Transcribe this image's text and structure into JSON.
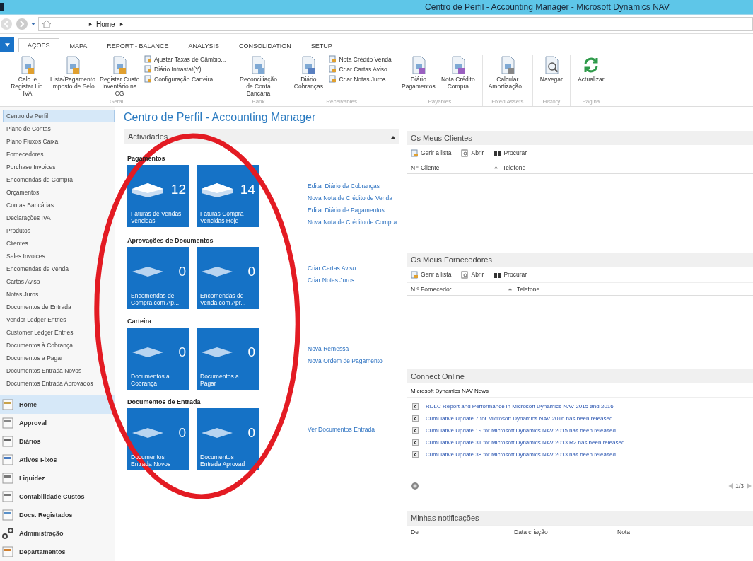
{
  "window": {
    "title": "Centro de Perfil - Accounting Manager - Microsoft Dynamics NAV"
  },
  "address": {
    "crumb": "Home"
  },
  "ribbon": {
    "tabs": [
      {
        "label": "AÇÕES",
        "selected": true
      },
      {
        "label": "MAPA",
        "selected": false
      },
      {
        "label": "REPORT - BALANCE",
        "selected": false
      },
      {
        "label": "ANALYSIS",
        "selected": false
      },
      {
        "label": "CONSOLIDATION",
        "selected": false
      },
      {
        "label": "SETUP",
        "selected": false
      }
    ],
    "groups": [
      {
        "label": "Geral",
        "items": [
          {
            "label": "Calc. e Registar Liq. IVA",
            "kind": "large"
          },
          {
            "label": "Lista/Pagamento Imposto de Selo",
            "kind": "large"
          },
          {
            "label": "Registar Custo Inventário na CG",
            "kind": "large"
          },
          {
            "label": "Ajustar Taxas de Câmbio...",
            "kind": "small"
          },
          {
            "label": "Diário Intrastat(Y)",
            "kind": "small"
          },
          {
            "label": "Configuração Carteira",
            "kind": "small"
          }
        ]
      },
      {
        "label": "Bank",
        "items": [
          {
            "label": "Reconciliação de Conta Bancária",
            "kind": "large"
          }
        ]
      },
      {
        "label": "Receivables",
        "items": [
          {
            "label": "Diário Cobranças",
            "kind": "large"
          },
          {
            "label": "Nota Crédito Venda",
            "kind": "small"
          },
          {
            "label": "Criar Cartas Aviso...",
            "kind": "small"
          },
          {
            "label": "Criar Notas Juros...",
            "kind": "small"
          }
        ]
      },
      {
        "label": "Payables",
        "items": [
          {
            "label": "Diário Pagamentos",
            "kind": "large"
          },
          {
            "label": "Nota Crédito Compra",
            "kind": "large"
          }
        ]
      },
      {
        "label": "Fixed Assets",
        "items": [
          {
            "label": "Calcular Amortização...",
            "kind": "large"
          }
        ]
      },
      {
        "label": "History",
        "items": [
          {
            "label": "Navegar",
            "kind": "large"
          }
        ]
      },
      {
        "label": "Página",
        "items": [
          {
            "label": "Actualizar",
            "kind": "large"
          }
        ]
      }
    ]
  },
  "sidebar": {
    "items": [
      {
        "label": "Centro de Perfil",
        "selected": true
      },
      {
        "label": "Plano de Contas",
        "selected": false
      },
      {
        "label": "Plano Fluxos Caixa",
        "selected": false
      },
      {
        "label": "Fornecedores",
        "selected": false
      },
      {
        "label": "Purchase Invoices",
        "selected": false
      },
      {
        "label": "Encomendas de Compra",
        "selected": false
      },
      {
        "label": "Orçamentos",
        "selected": false
      },
      {
        "label": "Contas Bancárias",
        "selected": false
      },
      {
        "label": "Declarações IVA",
        "selected": false
      },
      {
        "label": "Produtos",
        "selected": false
      },
      {
        "label": "Clientes",
        "selected": false
      },
      {
        "label": "Sales Invoices",
        "selected": false
      },
      {
        "label": "Encomendas de Venda",
        "selected": false
      },
      {
        "label": "Cartas Aviso",
        "selected": false
      },
      {
        "label": "Notas Juros",
        "selected": false
      },
      {
        "label": "Documentos de Entrada",
        "selected": false
      },
      {
        "label": "Vendor Ledger Entries",
        "selected": false
      },
      {
        "label": "Customer Ledger Entries",
        "selected": false
      },
      {
        "label": "Documentos à Cobrança",
        "selected": false
      },
      {
        "label": "Documentos a Pagar",
        "selected": false
      },
      {
        "label": "Documentos Entrada Novos",
        "selected": false
      },
      {
        "label": "Documentos Entrada Aprovados",
        "selected": false
      }
    ],
    "nav": [
      {
        "label": "Home",
        "selected": true
      },
      {
        "label": "Approval",
        "selected": false
      },
      {
        "label": "Diários",
        "selected": false
      },
      {
        "label": "Ativos Fixos",
        "selected": false
      },
      {
        "label": "Liquidez",
        "selected": false
      },
      {
        "label": "Contabilidade Custos",
        "selected": false
      },
      {
        "label": "Docs. Registados",
        "selected": false
      },
      {
        "label": "Administração",
        "selected": false
      },
      {
        "label": "Departamentos",
        "selected": false
      }
    ]
  },
  "page_title": "Centro de Perfil - Accounting Manager",
  "activities": {
    "title": "Actividades",
    "expanded": true,
    "sections": [
      {
        "title": "Pagamentos",
        "tiles": [
          {
            "count": "12",
            "label": "Faturas de Vendas Vencidas",
            "kind": "stack"
          },
          {
            "count": "14",
            "label": "Faturas Compra Vencidas Hoje",
            "kind": "stack"
          }
        ],
        "links": [
          "Editar Diário de Cobranças",
          "Nova Nota de Crédito de Venda",
          "Editar Diário de Pagamentos",
          "Nova Nota de Crédito de Compra"
        ]
      },
      {
        "title": "Aprovações de Documentos",
        "tiles": [
          {
            "count": "0",
            "label": "Encomendas de Compra com Ap...",
            "kind": "flat"
          },
          {
            "count": "0",
            "label": "Encomendas de Venda com Apr...",
            "kind": "flat"
          }
        ],
        "links": [
          "Criar Cartas Aviso...",
          "Criar Notas Juros..."
        ]
      },
      {
        "title": "Carteira",
        "tiles": [
          {
            "count": "0",
            "label": "Documentos à Cobrança",
            "kind": "flat"
          },
          {
            "count": "0",
            "label": "Documentos a Pagar",
            "kind": "flat"
          }
        ],
        "links": [
          "Nova Remessa",
          "Nova Ordem de Pagamento"
        ]
      },
      {
        "title": "Documentos de Entrada",
        "tiles": [
          {
            "count": "0",
            "label": "Documentos Entrada Novos",
            "kind": "flat"
          },
          {
            "count": "0",
            "label": "Documentos Entrada Aprovad",
            "kind": "flat"
          }
        ],
        "links": [
          "Ver Documentos Entrada"
        ]
      }
    ]
  },
  "customers": {
    "title": "Os Meus Clientes",
    "actions": [
      "Gerir a lista",
      "Abrir",
      "Procurar"
    ],
    "columns": [
      {
        "label": "N.º Cliente",
        "sorted": true
      },
      {
        "label": "Telefone",
        "sorted": false
      }
    ]
  },
  "vendors": {
    "title": "Os Meus Fornecedores",
    "actions": [
      "Gerir a lista",
      "Abrir",
      "Procurar"
    ],
    "columns": [
      {
        "label": "N.º Fornecedor",
        "sorted": true
      },
      {
        "label": "Telefone",
        "sorted": false
      }
    ]
  },
  "connect": {
    "title": "Connect Online",
    "subtitle": "Microsoft Dynamics NAV News",
    "items": [
      "RDLC Report and Performance in Microsoft Dynamics NAV 2015 and 2016",
      "Cumulative Update 7 for Microsoft Dynamics NAV 2016 has been released",
      "Cumulative Update 19 for Microsoft Dynamics NAV 2015 has been released",
      "Cumulative Update 31 for Microsoft Dynamics NAV 2013 R2 has been released",
      "Cumulative Update 38 for Microsoft Dynamics NAV 2013 has been released"
    ],
    "pager": "1/3"
  },
  "notifications": {
    "title": "Minhas notificações",
    "columns": [
      "De",
      "Data criação",
      "Nota"
    ]
  }
}
